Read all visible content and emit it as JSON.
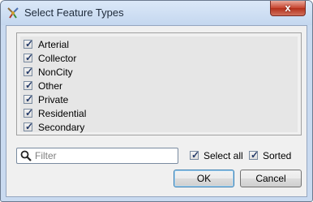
{
  "window": {
    "title": "Select Feature Types"
  },
  "titlebar": {
    "close_icon": "close-x-icon",
    "close_glyph": "x",
    "app_icon": "feature-types-icon"
  },
  "feature_list": {
    "items": [
      {
        "label": "Arterial",
        "checked": true
      },
      {
        "label": "Collector",
        "checked": true
      },
      {
        "label": "NonCity",
        "checked": true
      },
      {
        "label": "Other",
        "checked": true
      },
      {
        "label": "Private",
        "checked": true
      },
      {
        "label": "Residential",
        "checked": true
      },
      {
        "label": "Secondary",
        "checked": true
      }
    ]
  },
  "filter": {
    "placeholder": "Filter",
    "value": "",
    "icon": "search-icon"
  },
  "options": {
    "select_all": {
      "label": "Select all",
      "checked": true
    },
    "sorted": {
      "label": "Sorted",
      "checked": true
    }
  },
  "buttons": {
    "ok": "OK",
    "cancel": "Cancel"
  }
}
